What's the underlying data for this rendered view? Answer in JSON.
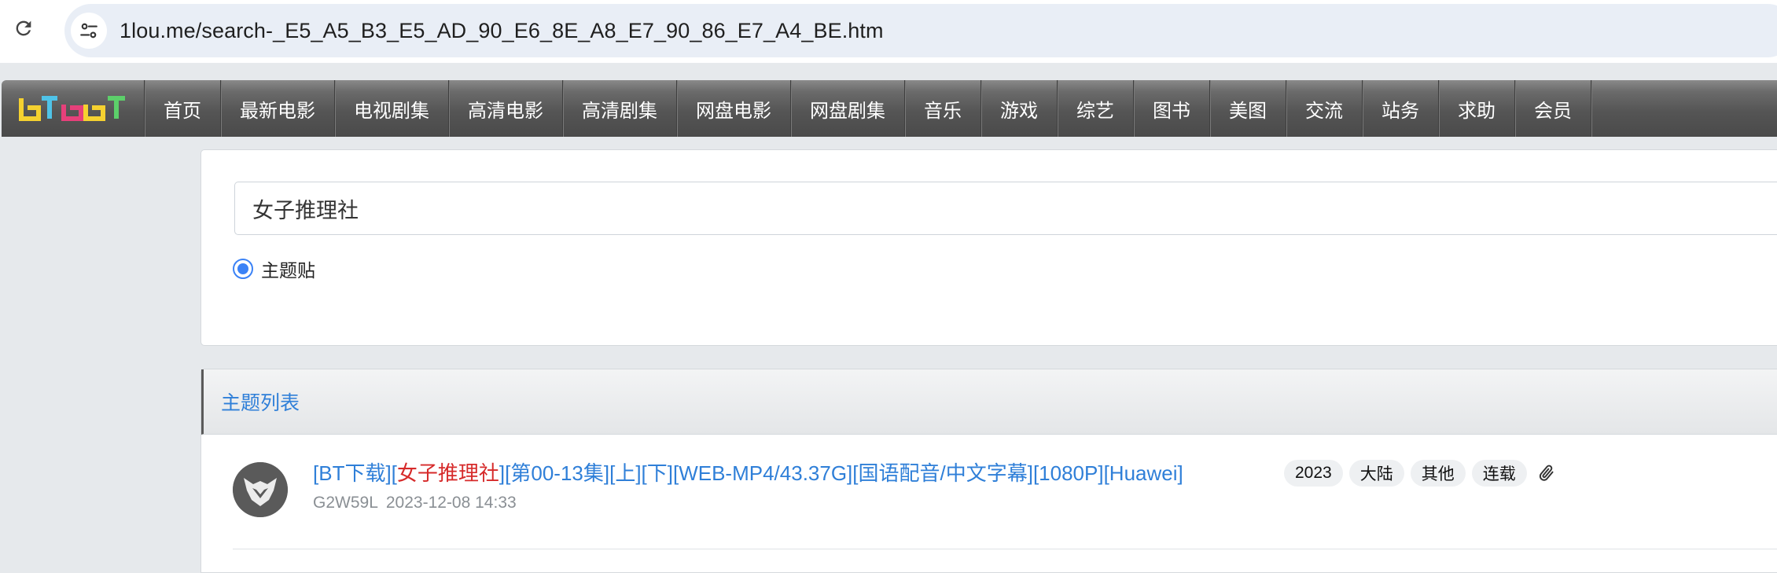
{
  "browser": {
    "url": "1lou.me/search-_E5_A5_B3_E5_AD_90_E6_8E_A8_E7_90_86_E7_A4_BE.htm",
    "reload_icon": "reload-icon",
    "site_info_icon": "tune-icon"
  },
  "site_nav": {
    "logo_text": "BTBBT",
    "items": [
      {
        "label": "首页"
      },
      {
        "label": "最新电影"
      },
      {
        "label": "电视剧集"
      },
      {
        "label": "高清电影"
      },
      {
        "label": "高清剧集"
      },
      {
        "label": "网盘电影"
      },
      {
        "label": "网盘剧集"
      },
      {
        "label": "音乐"
      },
      {
        "label": "游戏"
      },
      {
        "label": "综艺"
      },
      {
        "label": "图书"
      },
      {
        "label": "美图"
      },
      {
        "label": "交流"
      },
      {
        "label": "站务"
      },
      {
        "label": "求助"
      },
      {
        "label": "会员"
      }
    ]
  },
  "search": {
    "query": "女子推理社",
    "radio_label": "主题贴",
    "radio_checked": true
  },
  "thread_list": {
    "header": "主题列表",
    "threads": [
      {
        "title_prefix": "[BT下载][",
        "title_highlight": "女子推理社",
        "title_suffix": "][第00-13集][上][下][WEB-MP4/43.37G][国语配音/中文字幕][1080P][Huawei]",
        "tags": [
          "2023",
          "大陆",
          "其他",
          "连载"
        ],
        "attachment_icon": "paperclip-icon",
        "author": "G2W59L",
        "date": "2023-12-08 14:33"
      }
    ]
  },
  "colors": {
    "link_blue": "#2f7fd8",
    "highlight_red": "#d62a2a",
    "radio_blue": "#3b82f6"
  }
}
